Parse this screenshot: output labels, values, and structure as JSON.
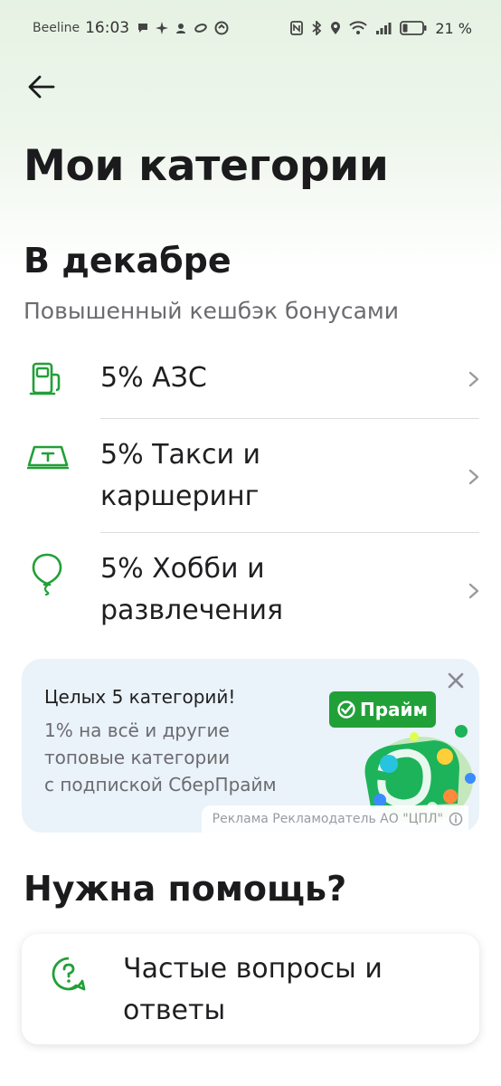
{
  "status_bar": {
    "carrier": "Beeline",
    "time": "16:03",
    "battery": "21 %"
  },
  "header": {
    "back_icon": "arrow-left-icon",
    "title": "Мои категории"
  },
  "section": {
    "title": "В декабре",
    "subtitle": "Повышенный кешбэк бонусами"
  },
  "categories": [
    {
      "icon": "fuel-station-icon",
      "label": "5% АЗС"
    },
    {
      "icon": "taxi-icon",
      "label_line1": "5% Такси и",
      "label_line2": "каршеринг"
    },
    {
      "icon": "balloon-icon",
      "label_line1": "5% Хобби и",
      "label_line2": "развлечения"
    }
  ],
  "promo": {
    "title": "Целых 5 категорий!",
    "body_line1": "1% на всё и другие",
    "body_line2": "топовые категории",
    "body_line3": "с подпиской СберПрайм",
    "badge": "Прайм",
    "disclaimer": "Реклама Рекламодатель АО \"ЦПЛ\"",
    "accent": "#21a038"
  },
  "help": {
    "title": "Нужна помощь?",
    "faq_line1": "Частые вопросы и",
    "faq_line2": "ответы"
  },
  "colors": {
    "brand_green": "#21a038",
    "text": "#1f1f22",
    "muted": "#6b6b70"
  }
}
